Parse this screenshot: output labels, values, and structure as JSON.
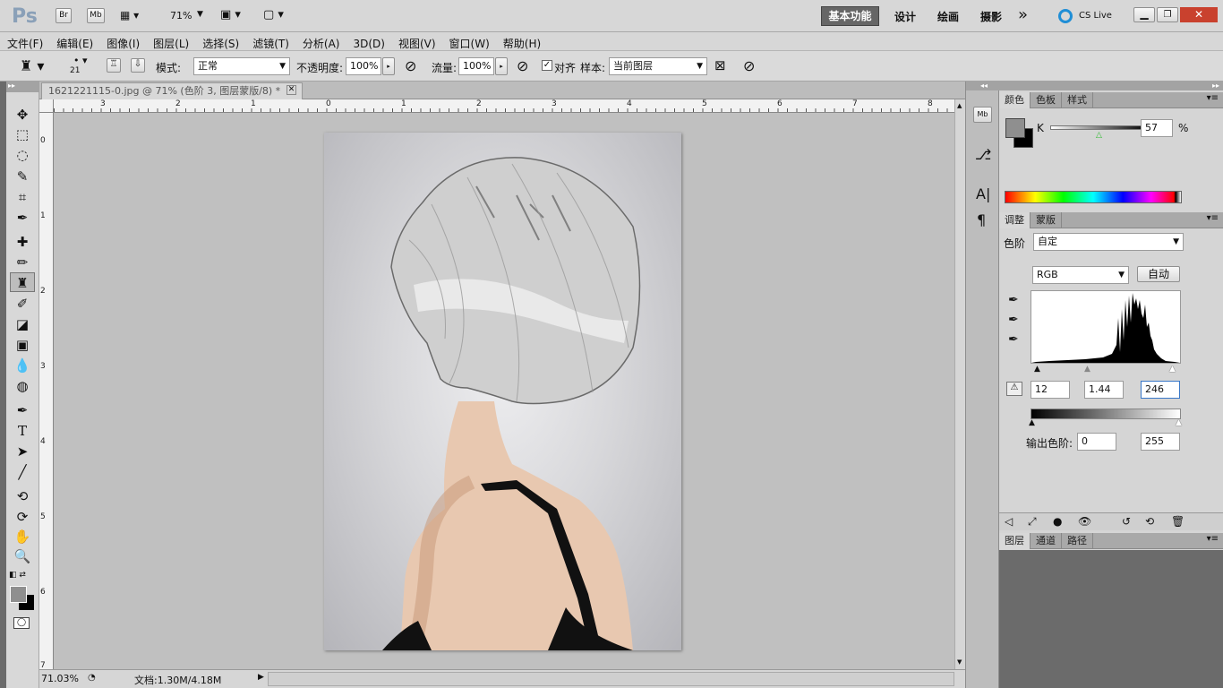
{
  "app": {
    "logo": "Ps",
    "bridge": "Br",
    "minibridge": "Mb",
    "zoom": "71%",
    "workspaces": [
      "基本功能",
      "设计",
      "绘画",
      "摄影"
    ],
    "more": "»",
    "cslive": "CS Live"
  },
  "menu": [
    "文件(F)",
    "编辑(E)",
    "图像(I)",
    "图层(L)",
    "选择(S)",
    "滤镜(T)",
    "分析(A)",
    "3D(D)",
    "视图(V)",
    "窗口(W)",
    "帮助(H)"
  ],
  "options": {
    "brush_size": "21",
    "mode_label": "模式:",
    "mode_value": "正常",
    "opacity_label": "不透明度:",
    "opacity_value": "100%",
    "flow_label": "流量:",
    "flow_value": "100%",
    "align_label": "对齐",
    "sample_label": "样本:",
    "sample_value": "当前图层"
  },
  "document": {
    "tab_title": "1621221115-0.jpg @ 71% (色阶 3, 图层蒙版/8) *",
    "zoom": "71.03%",
    "doc_info": "文档:1.30M/4.18M",
    "ruler_h": [
      "3",
      "2",
      "1",
      "0",
      "1",
      "2",
      "3",
      "4",
      "5",
      "6",
      "7",
      "8"
    ],
    "ruler_v": [
      "0",
      "1",
      "2",
      "3",
      "4",
      "5",
      "6",
      "7"
    ]
  },
  "color_panel": {
    "tabs": [
      "颜色",
      "色板",
      "样式"
    ],
    "channel": "K",
    "value": "57",
    "unit": "%",
    "fg": "#8f8f8f",
    "bg": "#000000"
  },
  "adjust_panel": {
    "tabs": [
      "调整",
      "蒙版"
    ],
    "preset_label": "色阶",
    "preset_value": "自定",
    "channel": "RGB",
    "auto_label": "自动",
    "input_black": "12",
    "input_gamma": "1.44",
    "input_white": "246",
    "output_label": "输出色阶:",
    "output_black": "0",
    "output_white": "255"
  },
  "layers_panel": {
    "tabs": [
      "图层",
      "通道",
      "路径"
    ]
  }
}
